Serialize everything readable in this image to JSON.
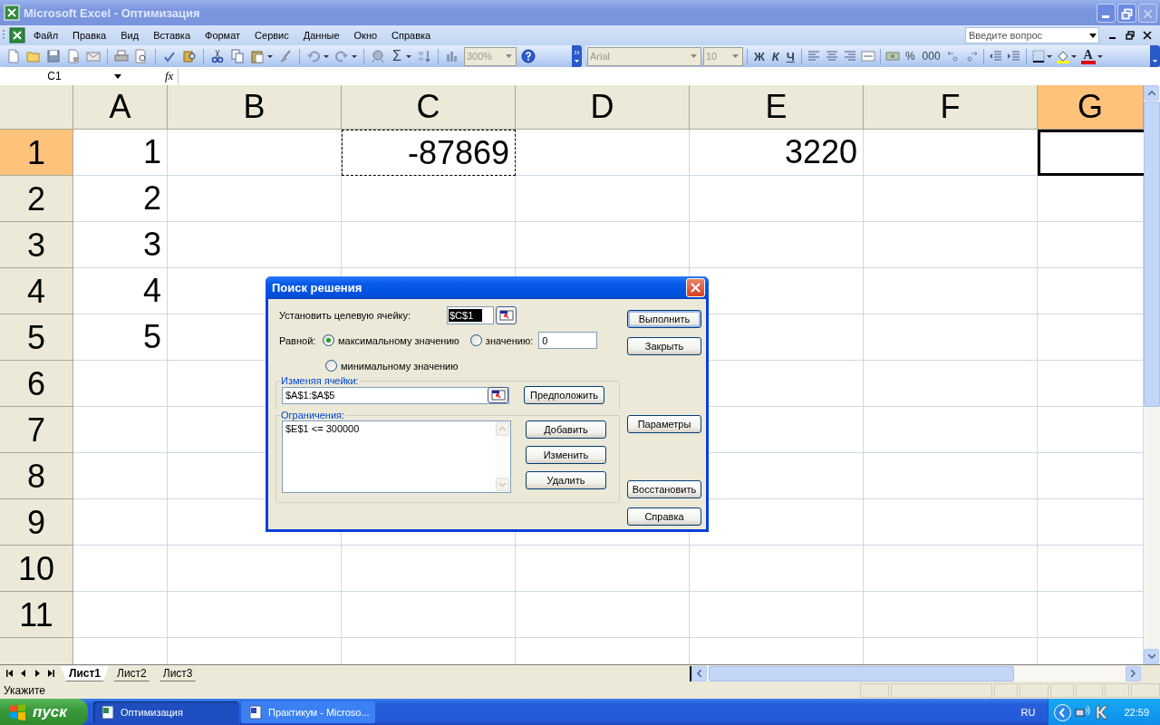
{
  "window": {
    "title": "Microsoft Excel - Оптимизация"
  },
  "menu": {
    "items": [
      "Файл",
      "Правка",
      "Вид",
      "Вставка",
      "Формат",
      "Сервис",
      "Данные",
      "Окно",
      "Справка"
    ],
    "help_box": {
      "placeholder": "Введите вопрос"
    }
  },
  "toolbar": {
    "sum": "Σ",
    "zoom": "300%",
    "font": "Arial",
    "size": "10",
    "bold": "Ж",
    "italic": "К",
    "underline": "Ч",
    "percent": "%",
    "thousands": "000",
    "font_color": "A"
  },
  "formula_bar": {
    "name_box": "C1",
    "fx": "fx"
  },
  "grid": {
    "columns": [
      {
        "label": "A",
        "selected": false
      },
      {
        "label": "B",
        "selected": false
      },
      {
        "label": "C",
        "selected": false
      },
      {
        "label": "D",
        "selected": false
      },
      {
        "label": "E",
        "selected": false
      },
      {
        "label": "F",
        "selected": false
      },
      {
        "label": "G",
        "selected": true
      }
    ],
    "rows": [
      {
        "header": "1",
        "selected": true,
        "cells": [
          {
            "value": "1",
            "marquee": false,
            "active": false
          },
          null,
          {
            "value": "-87869",
            "marquee": true,
            "active": false
          },
          null,
          {
            "value": "3220",
            "marquee": false,
            "active": false
          },
          null,
          {
            "marquee": false,
            "active": true
          }
        ]
      },
      {
        "header": "2",
        "selected": false,
        "cells": [
          {
            "value": "2",
            "marquee": false,
            "active": false
          },
          null,
          null,
          null,
          null,
          null,
          null
        ]
      },
      {
        "header": "3",
        "selected": false,
        "cells": [
          {
            "value": "3",
            "marquee": false,
            "active": false
          },
          null,
          null,
          null,
          null,
          null,
          null
        ]
      },
      {
        "header": "4",
        "selected": false,
        "cells": [
          {
            "value": "4",
            "marquee": false,
            "active": false
          },
          null,
          null,
          null,
          null,
          null,
          null
        ]
      },
      {
        "header": "5",
        "selected": false,
        "cells": [
          {
            "value": "5",
            "marquee": false,
            "active": false
          },
          null,
          null,
          null,
          null,
          null,
          null
        ]
      },
      {
        "header": "6",
        "selected": false,
        "cells": [
          null,
          null,
          null,
          null,
          null,
          null,
          null
        ]
      },
      {
        "header": "7",
        "selected": false,
        "cells": [
          null,
          null,
          null,
          null,
          null,
          null,
          null
        ]
      },
      {
        "header": "8",
        "selected": false,
        "cells": [
          null,
          null,
          null,
          null,
          null,
          null,
          null
        ]
      },
      {
        "header": "9",
        "selected": false,
        "cells": [
          null,
          null,
          null,
          null,
          null,
          null,
          null
        ]
      },
      {
        "header": "10",
        "selected": false,
        "cells": [
          null,
          null,
          null,
          null,
          null,
          null,
          null
        ]
      },
      {
        "header": "11",
        "selected": false,
        "cells": [
          null,
          null,
          null,
          null,
          null,
          null,
          null
        ]
      }
    ]
  },
  "sheet_tabs": [
    {
      "label": "Лист1",
      "selected": true
    },
    {
      "label": "Лист2",
      "selected": false
    },
    {
      "label": "Лист3",
      "selected": false
    }
  ],
  "status_bar": {
    "text": "Укажите"
  },
  "dialog": {
    "title": "Поиск решения",
    "target_label": "Установить целевую ячейку:",
    "target_value": "$C$1",
    "target_highlighted": true,
    "equal_label": "Равной:",
    "radios": [
      {
        "label": "максимальному значению",
        "selected": true
      },
      {
        "label": "значению:",
        "selected": false
      },
      {
        "label": "минимальному значению",
        "selected": false
      }
    ],
    "value_field": "0",
    "changing_label": "Изменяя ячейки:",
    "changing_value": "$A$1:$A$5",
    "guess_button": "Предположить",
    "constraints_label": "Ограничения:",
    "constraints": [
      "$E$1 <= 300000"
    ],
    "constraint_buttons": [
      "Добавить",
      "Изменить",
      "Удалить"
    ],
    "side_buttons": [
      {
        "label": "Выполнить",
        "default": true
      },
      {
        "label": "Закрыть",
        "default": false
      },
      {
        "label": "Параметры",
        "default": false
      },
      {
        "label": "Восстановить",
        "default": false
      },
      {
        "label": "Справка",
        "default": false
      }
    ]
  },
  "taskbar": {
    "start": "пуск",
    "tasks": [
      {
        "label": "Оптимизация",
        "selected": true
      },
      {
        "label": "Практикум - Microso...",
        "selected": false
      }
    ],
    "language": "RU",
    "clock": "22:59"
  }
}
